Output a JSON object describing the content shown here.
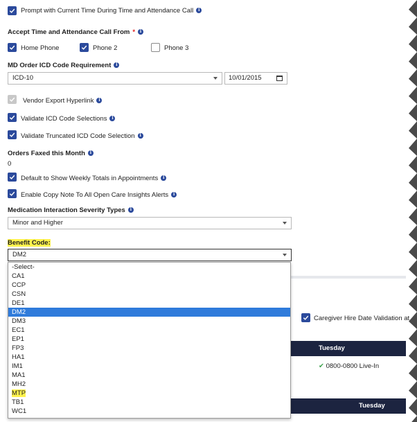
{
  "prompt_time": {
    "label": "Prompt with Current Time During Time and Attendance Call"
  },
  "accept_from": {
    "label": "Accept Time and Attendance Call From",
    "required_mark": "*",
    "options": [
      {
        "label": "Home Phone",
        "checked": true
      },
      {
        "label": "Phone 2",
        "checked": true
      },
      {
        "label": "Phone 3",
        "checked": false
      }
    ]
  },
  "icd": {
    "label": "MD Order ICD Code Requirement",
    "selected": "ICD-10",
    "date": "10/01/2015"
  },
  "vendor_export": {
    "label": "Vendor Export Hyperlink"
  },
  "validate_icd": {
    "label": "Validate ICD Code Selections"
  },
  "validate_truncated": {
    "label": "Validate Truncated ICD Code Selection"
  },
  "orders_faxed": {
    "label": "Orders Faxed this Month",
    "value": "0"
  },
  "weekly_totals": {
    "label": "Default to Show Weekly Totals in Appointments"
  },
  "copy_note": {
    "label": "Enable Copy Note To All Open Care Insights Alerts"
  },
  "severity": {
    "label": "Medication Interaction Severity Types",
    "selected": "Minor and Higher"
  },
  "benefit": {
    "label": "Benefit Code:",
    "selected": "DM2",
    "options": [
      "-Select-",
      "CA1",
      "CCP",
      "CSN",
      "DE1",
      "DM2",
      "DM3",
      "EC1",
      "EP1",
      "FP3",
      "HA1",
      "IM1",
      "MA1",
      "MH2",
      "MTP",
      "TB1",
      "WC1"
    ],
    "highlighted_option": "MTP"
  },
  "background": {
    "caregiver_label": "Caregiver Hire Date Validation at",
    "day_header_1": "Tuesday",
    "shift": "0800-0800 Live-In",
    "day_header_2": "Tuesday"
  },
  "colors": {
    "accent": "#2b4a9c",
    "selection": "#2f7bdb",
    "highlight": "#fff34d",
    "navy": "#1c2440"
  }
}
